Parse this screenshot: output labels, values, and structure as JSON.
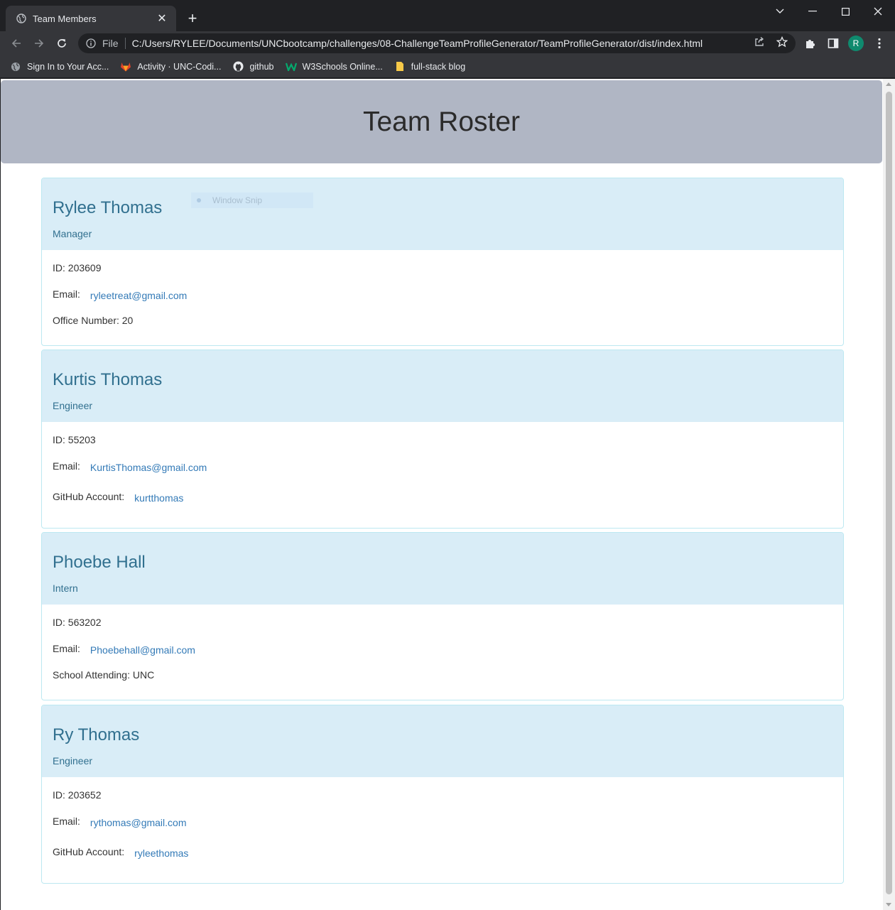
{
  "browser": {
    "tab_title": "Team Members",
    "url_scheme": "File",
    "url": "C:/Users/RYLEE/Documents/UNCbootcamp/challenges/08-ChallengeTeamProfileGenerator/TeamProfileGenerator/dist/index.html",
    "profile_initial": "R",
    "bookmarks": [
      {
        "label": "Sign In to Your Acc...",
        "icon": "globe-icon"
      },
      {
        "label": "Activity · UNC-Codi...",
        "icon": "gitlab-icon"
      },
      {
        "label": "github",
        "icon": "github-icon"
      },
      {
        "label": "W3Schools Online...",
        "icon": "w3schools-icon"
      },
      {
        "label": "full-stack blog",
        "icon": "folder-icon"
      }
    ]
  },
  "overlay": {
    "label": "Window Snip"
  },
  "page": {
    "title": "Team Roster",
    "members": [
      {
        "name": "Rylee Thomas",
        "role": "Manager",
        "id_label": "ID: 203609",
        "email_label": "Email:",
        "email": "ryleetreat@gmail.com",
        "extra_label": "Office Number: 20"
      },
      {
        "name": "Kurtis Thomas",
        "role": "Engineer",
        "id_label": "ID: 55203",
        "email_label": "Email:",
        "email": "KurtisThomas@gmail.com",
        "github_label": "GitHub Account:",
        "github": "kurtthomas"
      },
      {
        "name": "Phoebe Hall",
        "role": "Intern",
        "id_label": "ID: 563202",
        "email_label": "Email:",
        "email": "Phoebehall@gmail.com",
        "extra_label": "School Attending: UNC"
      },
      {
        "name": "Ry Thomas",
        "role": "Engineer",
        "id_label": "ID: 203652",
        "email_label": "Email:",
        "email": "rythomas@gmail.com",
        "github_label": "GitHub Account:",
        "github": "ryleethomas"
      }
    ]
  },
  "colors": {
    "jumbotron": "#b0b6c4",
    "card_header": "#d9edf7",
    "card_text": "#31708f",
    "link": "#337ab7"
  }
}
